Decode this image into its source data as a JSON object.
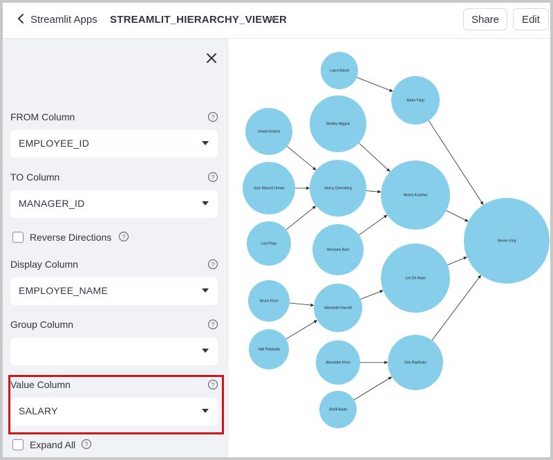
{
  "header": {
    "back_label": "Streamlit Apps",
    "app_name": "STREAMLIT_HIERARCHY_VIEWER",
    "share_label": "Share",
    "edit_label": "Edit"
  },
  "sidebar": {
    "from_column": {
      "label": "FROM Column",
      "value": "EMPLOYEE_ID"
    },
    "to_column": {
      "label": "TO Column",
      "value": "MANAGER_ID"
    },
    "reverse_directions": {
      "label": "Reverse Directions",
      "checked": false
    },
    "display_column": {
      "label": "Display Column",
      "value": "EMPLOYEE_NAME"
    },
    "group_column": {
      "label": "Group Column",
      "value": ""
    },
    "value_column": {
      "label": "Value Column",
      "value": "SALARY"
    },
    "expand_all": {
      "label": "Expand All",
      "checked": false
    }
  },
  "colors": {
    "node_fill": "#87ceeb",
    "highlight_border": "#d0161b",
    "sidebar_bg": "#f0f2f6"
  },
  "graph": {
    "nodes": [
      {
        "id": "laura",
        "label": "Laura Bissot"
      },
      {
        "id": "adam",
        "label": "Adam Fripp"
      },
      {
        "id": "shelley",
        "label": "Shelley Higgins"
      },
      {
        "id": "ismael",
        "label": "Ismael Sciarra"
      },
      {
        "id": "jose",
        "label": "Jose Manuel Urman"
      },
      {
        "id": "luis",
        "label": "Luis Popp"
      },
      {
        "id": "nancy",
        "label": "Nancy Greenberg"
      },
      {
        "id": "neena",
        "label": "Neena Kochhar"
      },
      {
        "id": "hermann",
        "label": "Hermann Baer"
      },
      {
        "id": "steven",
        "label": "Steven King"
      },
      {
        "id": "lex",
        "label": "Lex De Haan"
      },
      {
        "id": "bruce",
        "label": "Bruce Ernst"
      },
      {
        "id": "alexander_h",
        "label": "Alexander Hunold"
      },
      {
        "id": "valli",
        "label": "Valli Pataballa"
      },
      {
        "id": "alexander_k",
        "label": "Alexander Khoo"
      },
      {
        "id": "den",
        "label": "Den Raphealy"
      },
      {
        "id": "shelli",
        "label": "Shelli Baida"
      }
    ],
    "edges": [
      [
        "laura",
        "adam"
      ],
      [
        "adam",
        "steven"
      ],
      [
        "shelley",
        "neena"
      ],
      [
        "ismael",
        "nancy"
      ],
      [
        "jose",
        "nancy"
      ],
      [
        "luis",
        "nancy"
      ],
      [
        "nancy",
        "neena"
      ],
      [
        "hermann",
        "neena"
      ],
      [
        "neena",
        "steven"
      ],
      [
        "bruce",
        "alexander_h"
      ],
      [
        "valli",
        "alexander_h"
      ],
      [
        "alexander_h",
        "lex"
      ],
      [
        "lex",
        "steven"
      ],
      [
        "alexander_k",
        "den"
      ],
      [
        "shelli",
        "den"
      ],
      [
        "den",
        "steven"
      ]
    ]
  }
}
